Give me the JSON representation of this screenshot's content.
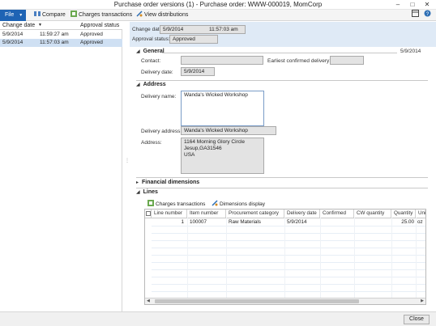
{
  "window": {
    "title": "Purchase order versions (1) - Purchase order: WWW-000019, MomCorp"
  },
  "toolbar": {
    "file_label": "File",
    "compare_label": "Compare",
    "charges_label": "Charges transactions",
    "view_dist_label": "View distributions"
  },
  "versions": {
    "col_change_date": "Change date",
    "col_status": "Approval status",
    "rows": [
      {
        "date": "5/9/2014",
        "time": "11:59:27 am",
        "status": "Approved"
      },
      {
        "date": "5/9/2014",
        "time": "11:57:03 am",
        "status": "Approved"
      }
    ]
  },
  "header": {
    "change_date_label": "Change date:",
    "change_date": "5/9/2014",
    "change_time": "11:57:03 am",
    "approval_status_label": "Approval status:",
    "approval_status": "Approved"
  },
  "general": {
    "title": "General",
    "date_badge": "5/9/2014",
    "contact_label": "Contact:",
    "contact": "",
    "earliest_label": "Earliest confirmed delivery:",
    "earliest": "",
    "delivery_date_label": "Delivery date:",
    "delivery_date": "5/9/2014"
  },
  "address": {
    "title": "Address",
    "delivery_name_label": "Delivery name:",
    "delivery_name": "Wanda's Wicked Workshop",
    "delivery_address_label": "Delivery address:",
    "delivery_address": "Wanda's Wicked Workshop",
    "address_label": "Address:",
    "address_line1": "1164 Morning Glory Circle",
    "address_line2": "Jesup,GA31546",
    "address_line3": "USA"
  },
  "financial": {
    "title": "Financial dimensions"
  },
  "lines": {
    "title": "Lines",
    "charges_label": "Charges transactions",
    "dimensions_label": "Dimensions display",
    "columns": [
      "Line number",
      "Item number",
      "Procurement category",
      "Delivery date",
      "Confirmed",
      "CW quantity",
      "Quantity",
      "Unit"
    ],
    "row": {
      "line": "1",
      "item": "100007",
      "category": "Raw Materials",
      "date": "5/9/2014",
      "confirmed": "",
      "cw": "",
      "qty": "25.00",
      "unit": "oz"
    }
  },
  "footer": {
    "close_label": "Close"
  },
  "colors": {
    "accent": "#1e63b4",
    "header_band": "#dfeaf6",
    "selected_row": "#cfe0f3"
  }
}
